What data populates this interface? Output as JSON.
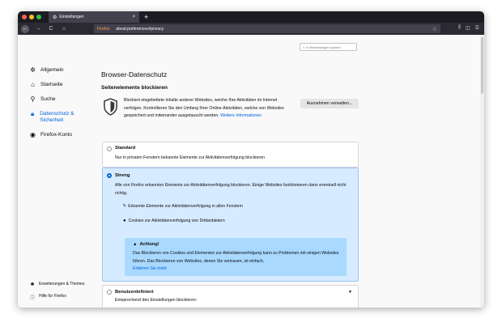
{
  "tab": {
    "title": "Einstellungen",
    "close": "×",
    "new_tab": "+"
  },
  "nav": {
    "back": "←",
    "forward": "→",
    "reload": "C",
    "home": "⌂"
  },
  "urlbar": {
    "brand": "Firefox",
    "url": "about:preferences#privacy"
  },
  "search": {
    "placeholder": "In Einstellungen suchen"
  },
  "sidebar": {
    "items": [
      {
        "label": "Allgemein",
        "icon": "gear-icon"
      },
      {
        "label": "Startseite",
        "icon": "home-icon"
      },
      {
        "label": "Suche",
        "icon": "search-icon"
      },
      {
        "label": "Datenschutz & Sicherheit",
        "icon": "lock-icon",
        "active": true
      },
      {
        "label": "Firefox-Konto",
        "icon": "account-icon"
      }
    ],
    "bottom": [
      {
        "label": "Erweiterungen & Themes",
        "icon": "puzzle-icon"
      },
      {
        "label": "Hilfe für Firefox",
        "icon": "help-icon"
      }
    ]
  },
  "main": {
    "title": "Browser-Datenschutz",
    "section_title": "Seitenelemente blockieren",
    "intro_text": "Blockiert eingebettete Inhalte anderer Websites, welche Ihre Aktivitäten im Internet verfolgen. Kontrollieren Sie den Umfang Ihrer Online-Aktivitäten, welche von Websites gespeichert und miteinander ausgetauscht werden.",
    "intro_link": "Weitere Informationen",
    "exceptions_button": "Ausnahmen verwalten..."
  },
  "options": {
    "standard": {
      "title": "Standard",
      "desc": "Nur in privaten Fenstern bekannte Elemente zur Aktivitätenverfolgung blockieren"
    },
    "strict": {
      "title": "Streng",
      "desc": "Alle von Firefox erkannten Elemente zur Aktivitätenverfolgung blockieren. Einige Websites funktionieren dann eventuell nicht richtig.",
      "bullet1": "Erkannte Elemente zur Aktivitätenverfolgung in allen Fenstern",
      "bullet2": "Cookies zur Aktivitätenverfolgung von Drittanbietern",
      "warning_title": "Achtung!",
      "warning_text": "Das Blockieren von Cookies und Elementen zur Aktivitätenverfolgung kann zu Problemen mit einigen Websites führen. Das Blockieren von Websites, denen Sie vertrauen, ist einfach.",
      "warning_link": "Erfahren Sie mehr"
    },
    "custom": {
      "title": "Benutzerdefiniert",
      "desc": "Entsprechend den Einstellungen blockieren:"
    }
  },
  "colors": {
    "accent": "#0060df",
    "strict_bg": "#d6ebff",
    "warning_bg": "#a9d9ff",
    "toolbar": "#2b2a33"
  }
}
